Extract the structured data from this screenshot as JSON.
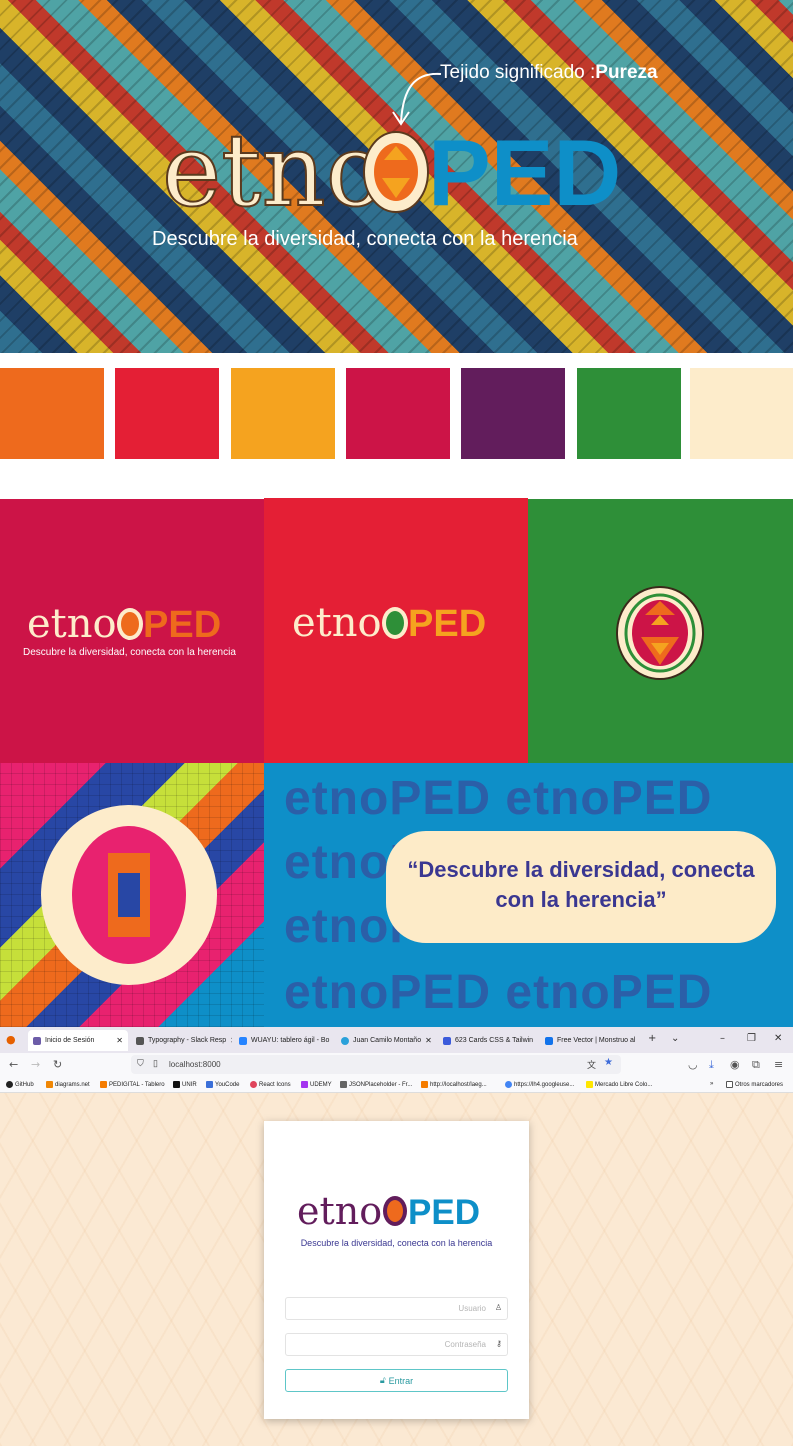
{
  "hero": {
    "note_prefix": "Tejido significado :",
    "note_bold": "Pureza",
    "logo_text_left": "etno",
    "logo_text_right": "PED",
    "tagline": "Descubre la diversidad, conecta con la herencia"
  },
  "palette": [
    "#ee6a1d",
    "#e41f35",
    "#f5a31f",
    "#cc1447",
    "#621d5c",
    "#2e8f38",
    "#fdeccb"
  ],
  "panels": {
    "panel1": {
      "logo_left": "etno",
      "logo_right": "PED",
      "tagline": "Descubre la diversidad, conecta con la herencia"
    },
    "panel2": {
      "logo_left": "etno",
      "logo_right": "PED"
    },
    "panel5": {
      "bg_word_left": "etno",
      "bg_word_right": "PED",
      "quote": "“Descubre la diversidad, conecta con la herencia”"
    }
  },
  "browser": {
    "tabs": [
      {
        "label": "Inicio de Sesión",
        "icon": "etnoped-icon",
        "color": "#6c5ca8",
        "active": true
      },
      {
        "label": "Typography - Slack Resp",
        "icon": "layers-icon",
        "color": "#555555",
        "active": false
      },
      {
        "label": "WUAYU: tablero ágil - Bo",
        "icon": "jira-icon",
        "color": "#2684ff",
        "active": false
      },
      {
        "label": "Juan Camilo Montaño",
        "icon": "telegram-icon",
        "color": "#2aa1da",
        "active": false
      },
      {
        "label": "623 Cards CSS & Tailwin",
        "icon": "ui-icon",
        "color": "#3b5bdb",
        "active": false
      },
      {
        "label": "Free Vector | Monstruo al",
        "icon": "freepik-icon",
        "color": "#1273eb",
        "active": false
      }
    ],
    "url": "localhost:8000",
    "bookmarks": [
      "GitHub",
      "diagrams.net",
      "PEDIGITAL - Tablero",
      "UNIR",
      "YouCode",
      "React Icons",
      "UDEMY",
      "JSONPlaceholder - Fr...",
      "http://localhost/laeg...",
      "https://lh4.googleuse...",
      "Mercado Libre Colo...",
      "Otros marcadores"
    ],
    "login": {
      "logo_left": "etno",
      "logo_right": "PED",
      "tagline": "Descubre la diversidad, conecta con la herencia",
      "username_placeholder": "Usuario",
      "password_placeholder": "Contraseña",
      "submit_label": "Entrar"
    }
  }
}
